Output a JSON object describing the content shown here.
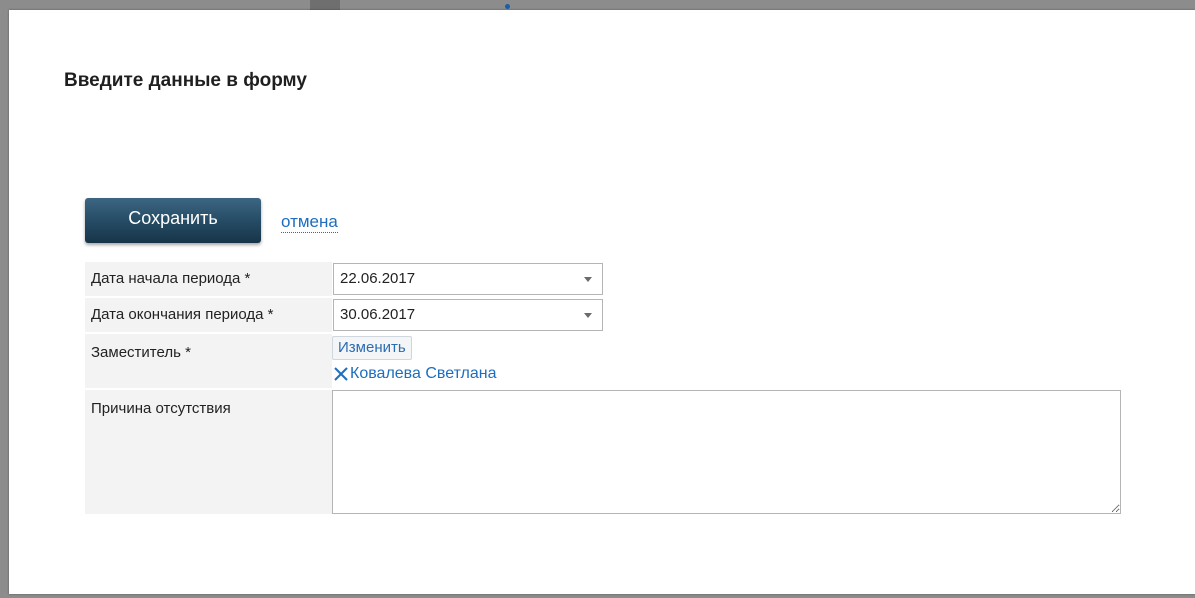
{
  "dialog": {
    "title": "Введите данные в форму"
  },
  "actions": {
    "save_label": "Сохранить",
    "cancel_label": "отмена"
  },
  "form": {
    "start_date": {
      "label": "Дата начала периода *",
      "value": "22.06.2017"
    },
    "end_date": {
      "label": "Дата окончания периода *",
      "value": "30.06.2017"
    },
    "deputy": {
      "label": "Заместитель *",
      "change_label": "Изменить",
      "selected_name": "Ковалева Светлана"
    },
    "reason": {
      "label": "Причина отсутствия",
      "value": ""
    }
  },
  "colors": {
    "accent_link": "#1e6dbf",
    "save_button": "#244a63"
  },
  "icons": {
    "dropdown": "chevron-down-icon",
    "remove": "close-icon"
  }
}
